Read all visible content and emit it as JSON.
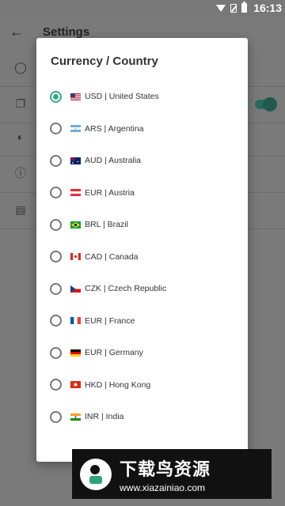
{
  "status_bar": {
    "time": "16:13"
  },
  "settings": {
    "title": "Settings"
  },
  "dialog": {
    "title": "Currency / Country",
    "selected_index": 0,
    "accent_color": "#33a98c",
    "items": [
      {
        "label": "USD  |  United States",
        "flag": "flag-us"
      },
      {
        "label": "ARS  |  Argentina",
        "flag": "flag-ar"
      },
      {
        "label": "AUD  |  Australia",
        "flag": "flag-au"
      },
      {
        "label": "EUR  |  Austria",
        "flag": "flag-at"
      },
      {
        "label": "BRL  |  Brazil",
        "flag": "flag-br"
      },
      {
        "label": "CAD  |  Canada",
        "flag": "flag-ca"
      },
      {
        "label": "CZK  |  Czech Republic",
        "flag": "flag-cz"
      },
      {
        "label": "EUR  |  France",
        "flag": "flag-fr"
      },
      {
        "label": "EUR  |  Germany",
        "flag": "flag-de"
      },
      {
        "label": "HKD  |  Hong Kong",
        "flag": "flag-hk"
      },
      {
        "label": "INR  |  India",
        "flag": "flag-in"
      }
    ]
  },
  "watermark": {
    "title": "下载鸟资源",
    "url": "www.xiazainiao.com"
  }
}
